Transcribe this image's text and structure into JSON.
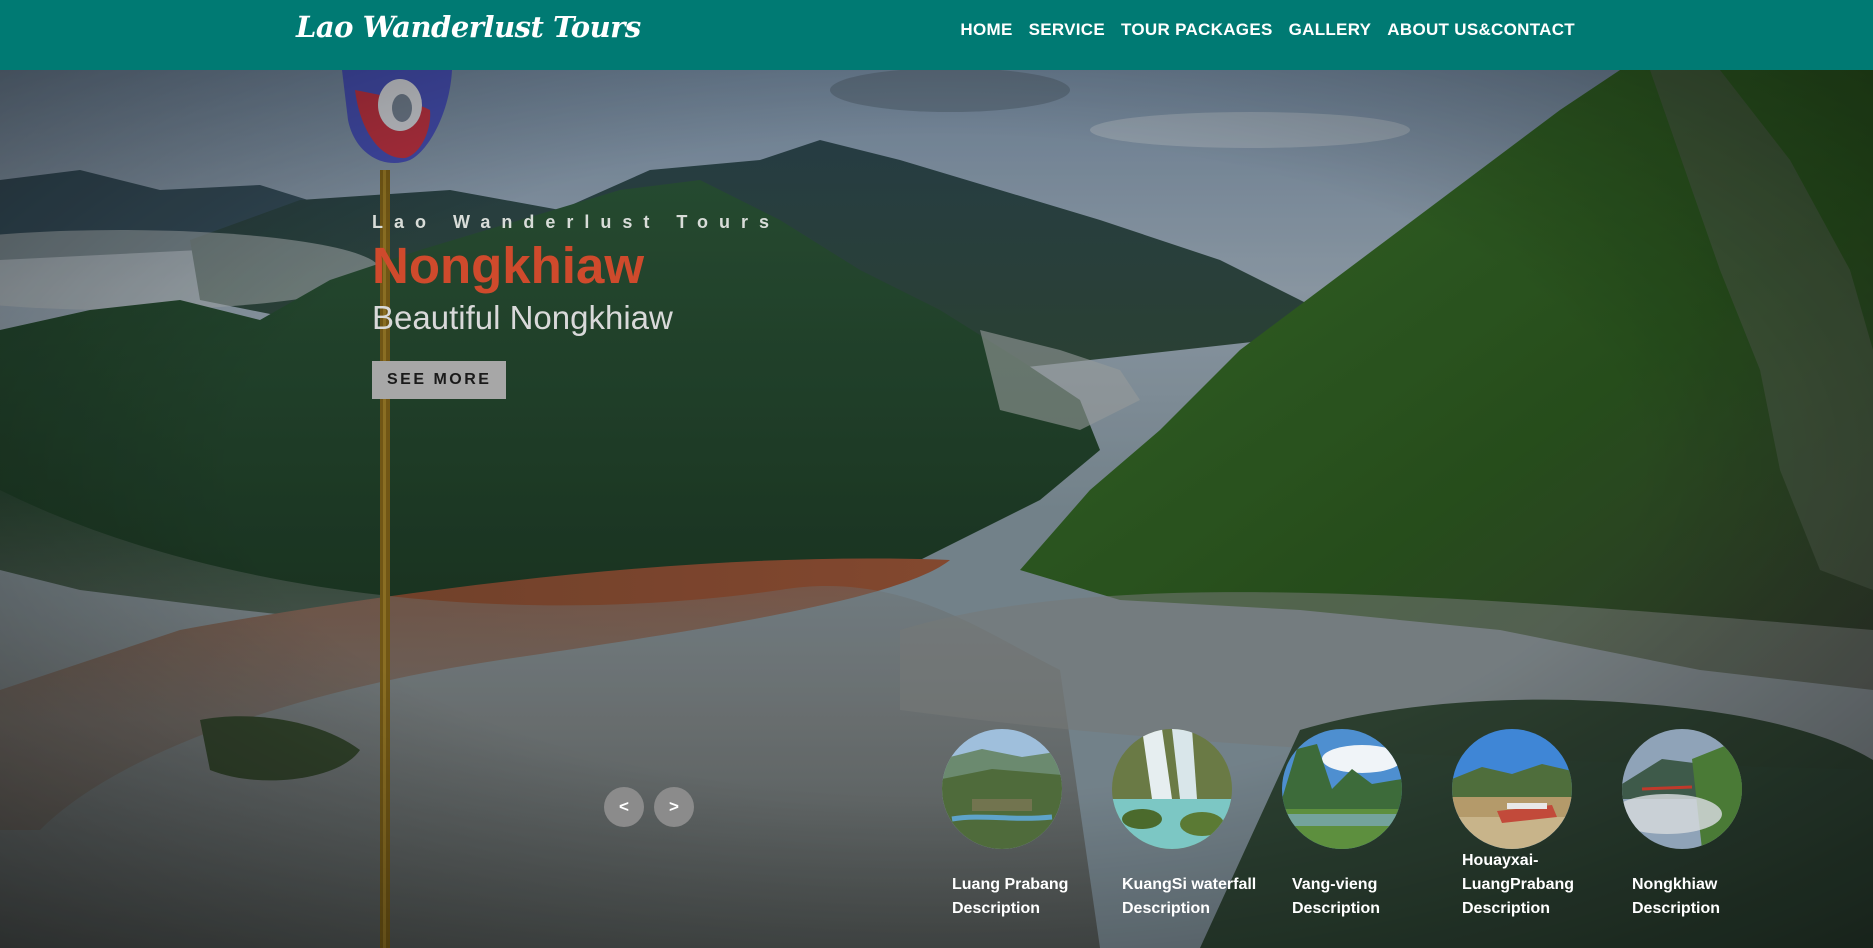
{
  "brand": {
    "name": "Lao Wanderlust Tours"
  },
  "nav": {
    "items": [
      {
        "label": "HOME"
      },
      {
        "label": "SERVICE"
      },
      {
        "label": "TOUR PACKAGES"
      },
      {
        "label": "GALLERY"
      },
      {
        "label": "ABOUT US&CONTACT"
      }
    ]
  },
  "hero": {
    "eyebrow": "Lao Wanderlust Tours",
    "title": "Nongkhiaw",
    "subtitle": "Beautiful Nongkhiaw",
    "cta_label": "SEE MORE",
    "prev_label": "<",
    "next_label": ">"
  },
  "thumbnails": [
    {
      "title": "Luang Prabang",
      "description": "Description"
    },
    {
      "title": "KuangSi waterfall",
      "description": "Description"
    },
    {
      "title": "Vang-vieng",
      "description": "Description"
    },
    {
      "title": "Houayxai-LuangPrabang",
      "description": "Description"
    },
    {
      "title": "Nongkhiaw",
      "description": "Description"
    }
  ],
  "colors": {
    "navbar": "#007a73",
    "accent": "#cf4a2c",
    "button": "#a7a7a7"
  }
}
